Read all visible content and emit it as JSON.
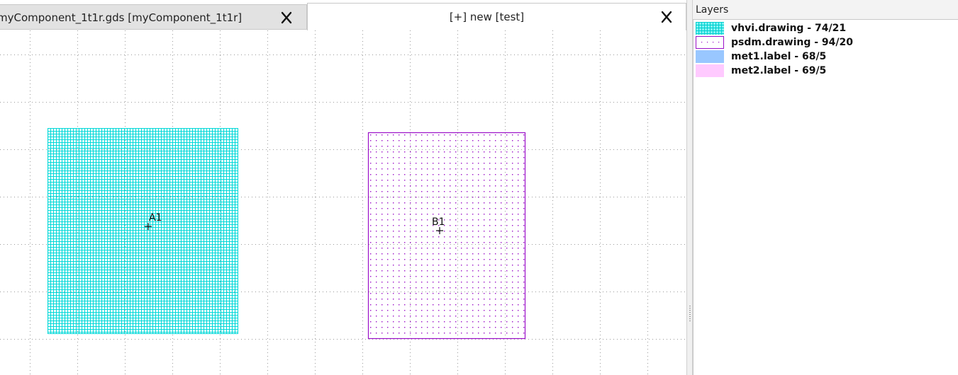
{
  "tabs": [
    {
      "label": "myComponent_1t1r.gds [myComponent_1t1r]",
      "active": false
    },
    {
      "label": "[+] new [test]",
      "active": true
    }
  ],
  "canvas": {
    "labels": [
      {
        "text": "A1"
      },
      {
        "text": "B1"
      }
    ],
    "colors": {
      "vhvi": "#00e5e5",
      "psdm": "#9b10c8",
      "grid_dot": "#9a9a9a"
    }
  },
  "layers_panel": {
    "title": "Layers",
    "items": [
      {
        "name": "vhvi.drawing - 74/21",
        "color": "#00e5e5",
        "fill": "grid"
      },
      {
        "name": "psdm.drawing - 94/20",
        "color": "#9b10c8",
        "fill": "dots"
      },
      {
        "name": "met1.label - 68/5",
        "color": "#99c7ff",
        "fill": "solid"
      },
      {
        "name": "met2.label - 69/5",
        "color": "#ffcaff",
        "fill": "solid"
      }
    ]
  }
}
